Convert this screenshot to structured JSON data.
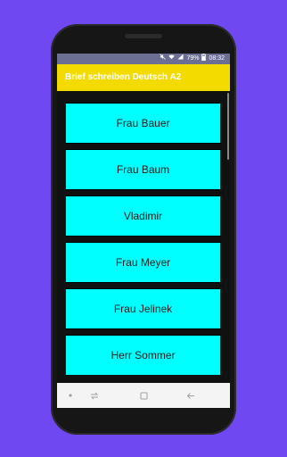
{
  "status_bar": {
    "mute_icon": "mute-icon",
    "wifi_icon": "wifi-icon",
    "signal_icon": "signal-icon",
    "battery_percent": "79%",
    "battery_icon": "battery-icon",
    "time": "08:32"
  },
  "app_bar": {
    "title": "Brief schreiben Deutsch A2"
  },
  "list": {
    "items": [
      {
        "label": "Frau Bauer"
      },
      {
        "label": "Frau Baum"
      },
      {
        "label": "Vladimir"
      },
      {
        "label": "Frau Meyer"
      },
      {
        "label": "Frau Jelinek"
      },
      {
        "label": "Herr Sommer"
      }
    ]
  },
  "nav_bar": {
    "dot_icon": "dot-icon",
    "switch_icon": "switch-apps-icon",
    "home_icon": "overview-square-icon",
    "back_icon": "back-arrow-icon"
  },
  "colors": {
    "background": "#6f48f2",
    "status_bar": "#6b6f93",
    "app_bar": "#f3db00",
    "list_item": "#00ffff"
  }
}
